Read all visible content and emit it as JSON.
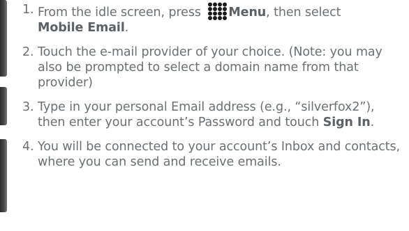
{
  "steps": [
    {
      "number": "1.",
      "text_before": "From the idle screen, press ",
      "icon": "menu-grid-icon",
      "bold1": "Menu",
      "text_middle": ", then select ",
      "bold2": "Mobile Email",
      "text_after": "."
    },
    {
      "number": "2.",
      "text": "Touch the e-mail provider of your choice. (Note: you may also be prompted to select a domain name from that provider)"
    },
    {
      "number": "3.",
      "text_before": "Type in your personal Email address (e.g., “silverfox2”), then enter your account’s Password and touch ",
      "bold": "Sign In",
      "text_after": "."
    },
    {
      "number": "4.",
      "text": "You will be connected to your account’s Inbox and contacts, where you can send and receive emails."
    }
  ],
  "colors": {
    "text": "#6b7073",
    "icon": "#1a1a1a"
  }
}
